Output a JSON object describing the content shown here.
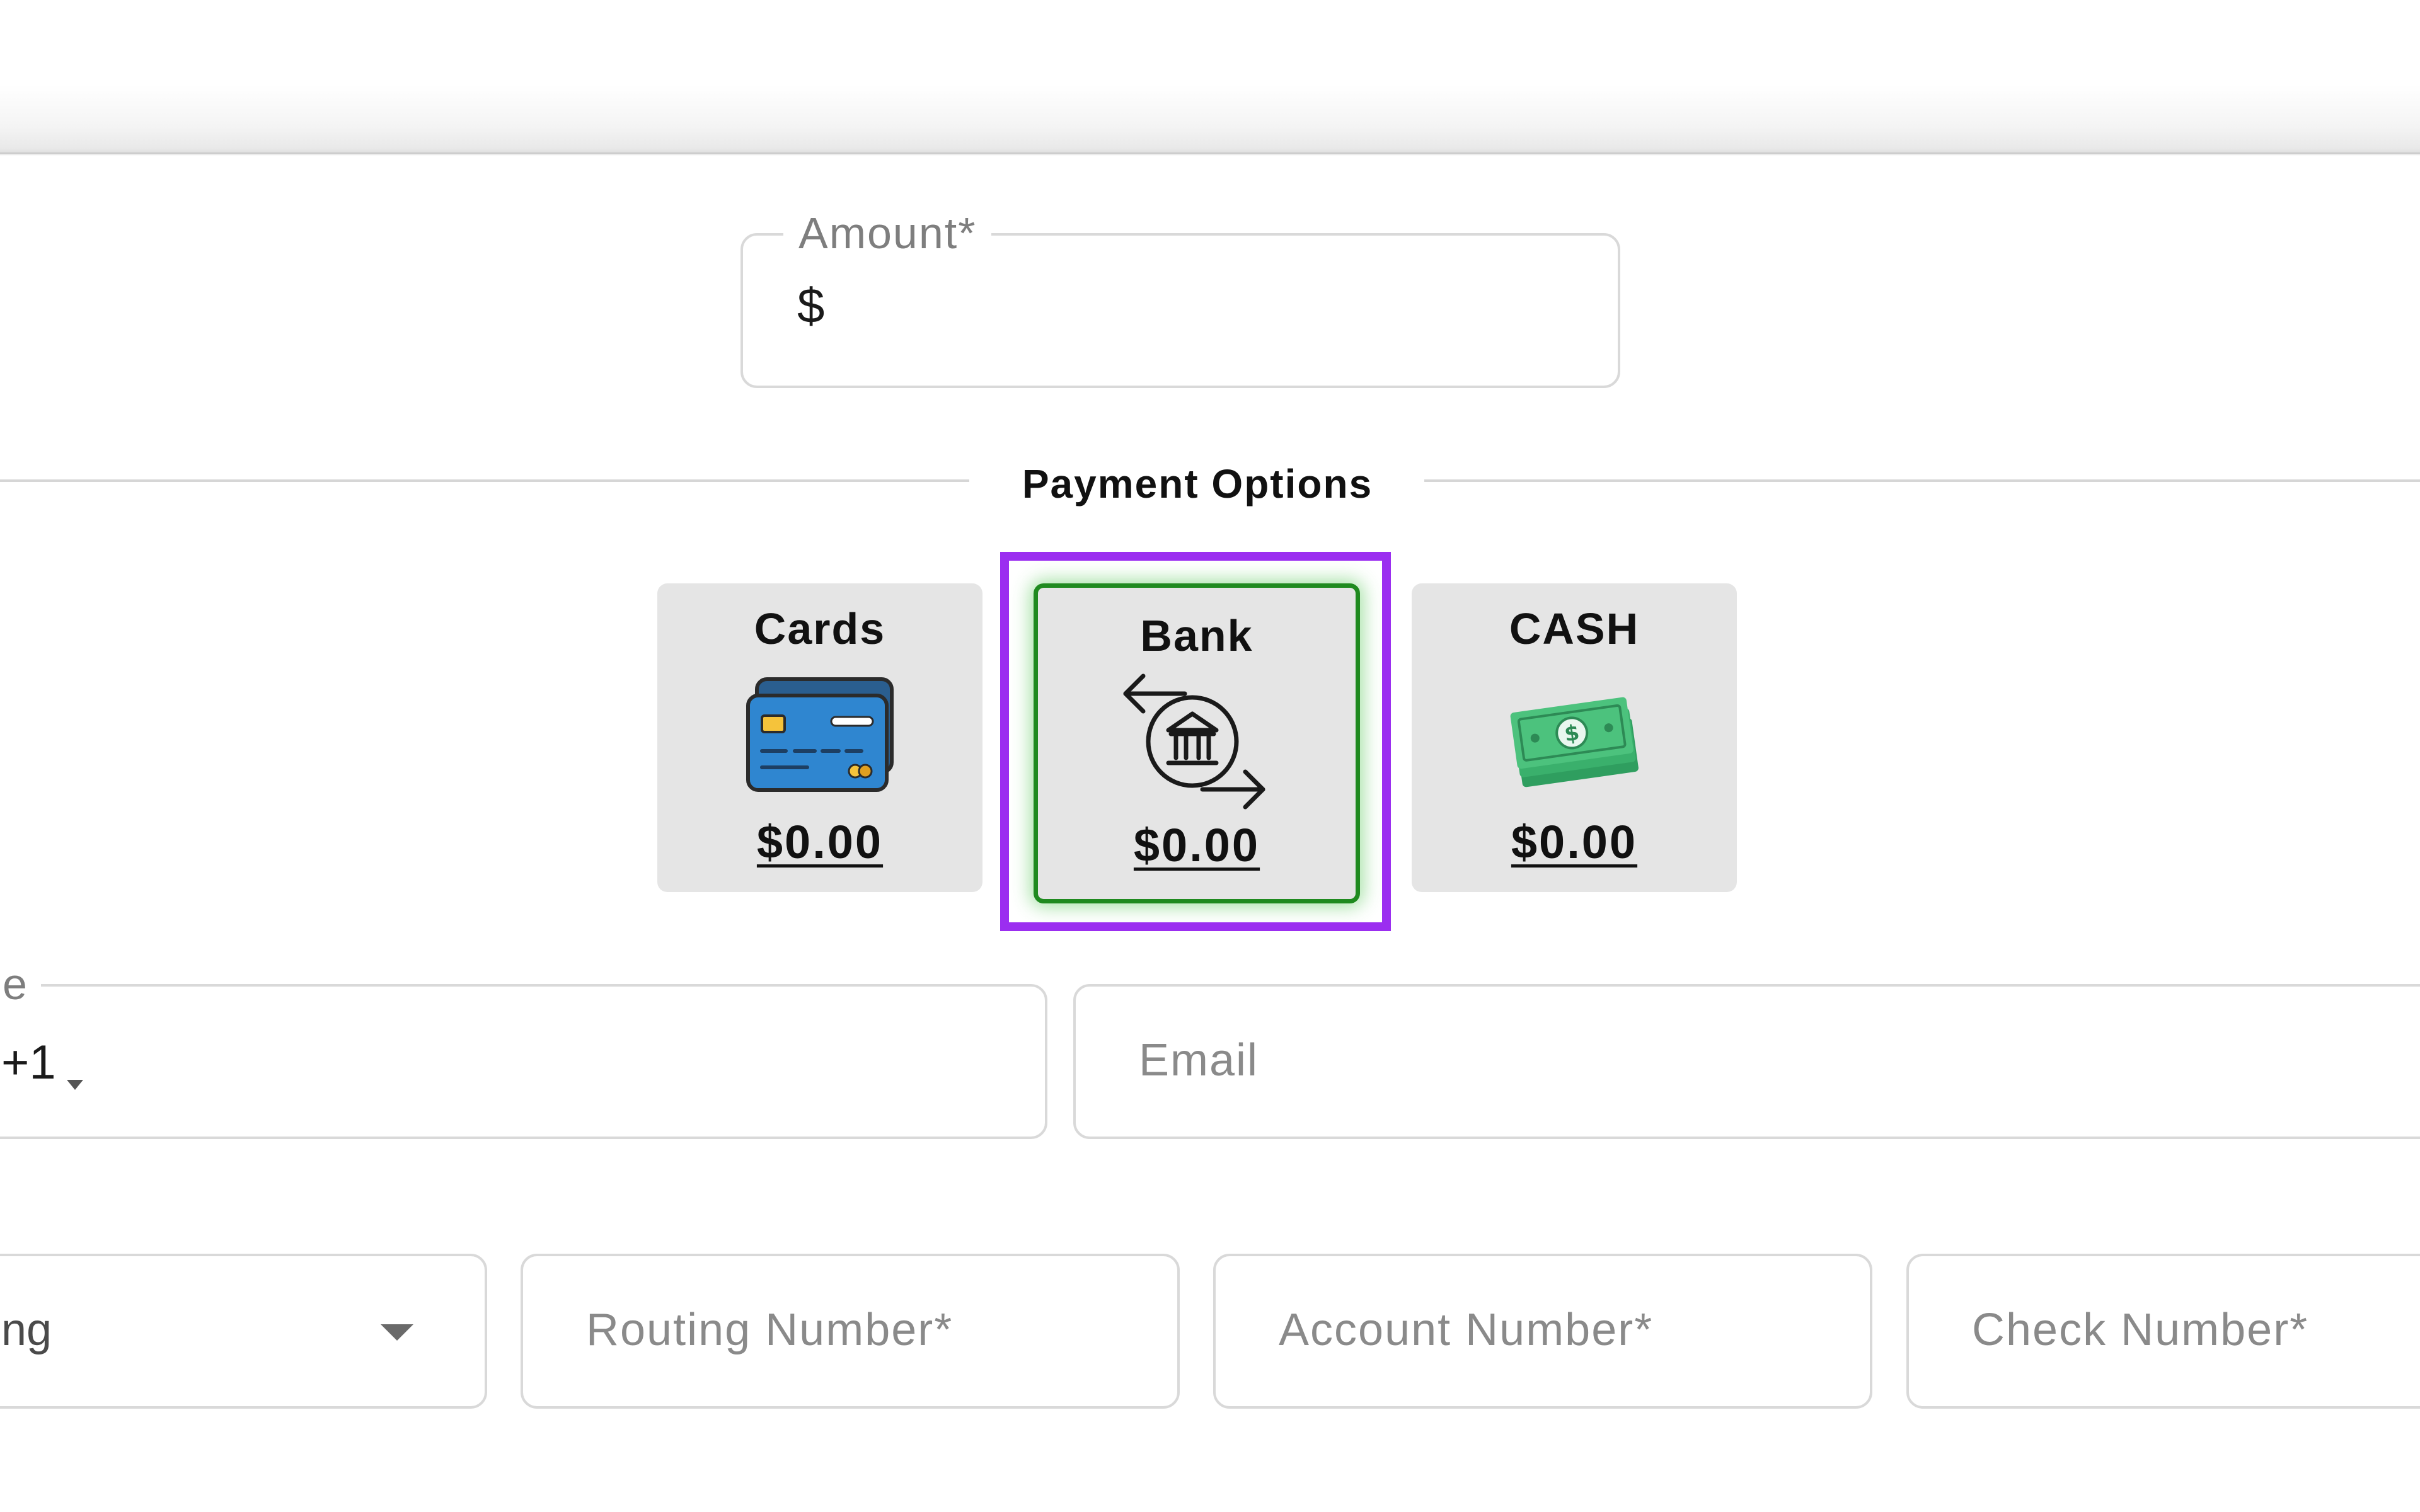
{
  "amount_field": {
    "label": "Amount*",
    "prefix": "$",
    "value": ""
  },
  "payment_options": {
    "title": "Payment Options",
    "options": [
      {
        "label": "Cards",
        "amount": "$0.00",
        "icon": "credit-cards-icon",
        "selected": false
      },
      {
        "label": "Bank",
        "amount": "$0.00",
        "icon": "bank-transfer-icon",
        "selected": true
      },
      {
        "label": "CASH",
        "amount": "$0.00",
        "icon": "cash-icon",
        "selected": false
      }
    ]
  },
  "contact": {
    "phone_label_partial": "e",
    "phone_country_code": "+1",
    "email_placeholder": "Email"
  },
  "bank_details": {
    "account_type_partial": "ng",
    "routing_placeholder": "Routing Number*",
    "account_placeholder": "Account Number*",
    "check_placeholder": "Check Number*"
  },
  "colors": {
    "selected_border": "#1f8a1f",
    "focus_ring": "#9b2ef0",
    "card_background": "#e5e5e5"
  }
}
